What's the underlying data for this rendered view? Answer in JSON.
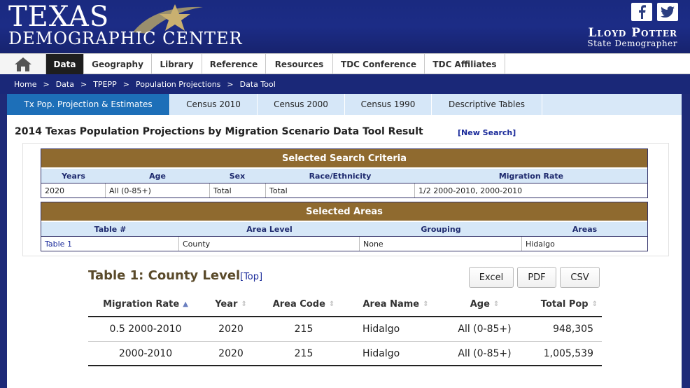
{
  "banner": {
    "logo_line1": "TEXAS",
    "logo_line2": "DEMOGRAPHIC CENTER",
    "demographer_name": "Lloyd Potter",
    "demographer_title": "State Demographer",
    "social": [
      "facebook-icon",
      "twitter-icon"
    ]
  },
  "nav": {
    "home_icon": "home-icon",
    "items": [
      "Data",
      "Geography",
      "Library",
      "Reference",
      "Resources",
      "TDC Conference",
      "TDC Affiliates"
    ],
    "active": "Data"
  },
  "breadcrumb": [
    "Home",
    "Data",
    "TPEPP",
    "Population Projections",
    "Data Tool"
  ],
  "breadcrumb_sep": ">",
  "subtabs": {
    "items": [
      "Tx Pop. Projection & Estimates",
      "Census 2010",
      "Census 2000",
      "Census 1990",
      "Descriptive Tables"
    ],
    "active": "Tx Pop. Projection & Estimates"
  },
  "result": {
    "title": "2014 Texas Population Projections by Migration Scenario Data Tool Result",
    "new_search": "[New Search]"
  },
  "criteria": {
    "heading": "Selected Search Criteria",
    "columns": [
      "Years",
      "Age",
      "Sex",
      "Race/Ethnicity",
      "Migration Rate"
    ],
    "row": [
      "2020",
      "All (0-85+)",
      "Total",
      "Total",
      "1/2 2000-2010, 2000-2010"
    ]
  },
  "areas": {
    "heading": "Selected Areas",
    "columns": [
      "Table #",
      "Area Level",
      "Grouping",
      "Areas"
    ],
    "row": [
      "Table 1",
      "County",
      "None",
      "Hidalgo"
    ]
  },
  "table1": {
    "title": "Table 1: County Level",
    "top_link": "[Top]",
    "export_buttons": [
      "Excel",
      "PDF",
      "CSV"
    ],
    "columns": [
      "Migration Rate",
      "Year",
      "Area Code",
      "Area Name",
      "Age",
      "Total Pop"
    ],
    "sorted_column": "Migration Rate",
    "rows": [
      [
        "0.5 2000-2010",
        "2020",
        "215",
        "Hidalgo",
        "All (0-85+)",
        "948,305"
      ],
      [
        "2000-2010",
        "2020",
        "215",
        "Hidalgo",
        "All (0-85+)",
        "1,005,539"
      ]
    ]
  },
  "colors": {
    "brand_navy": "#1a2a80",
    "criteria_header": "#8f6a2f",
    "active_subtab": "#1d6fb8",
    "column_header_bg": "#d6e7f7"
  }
}
